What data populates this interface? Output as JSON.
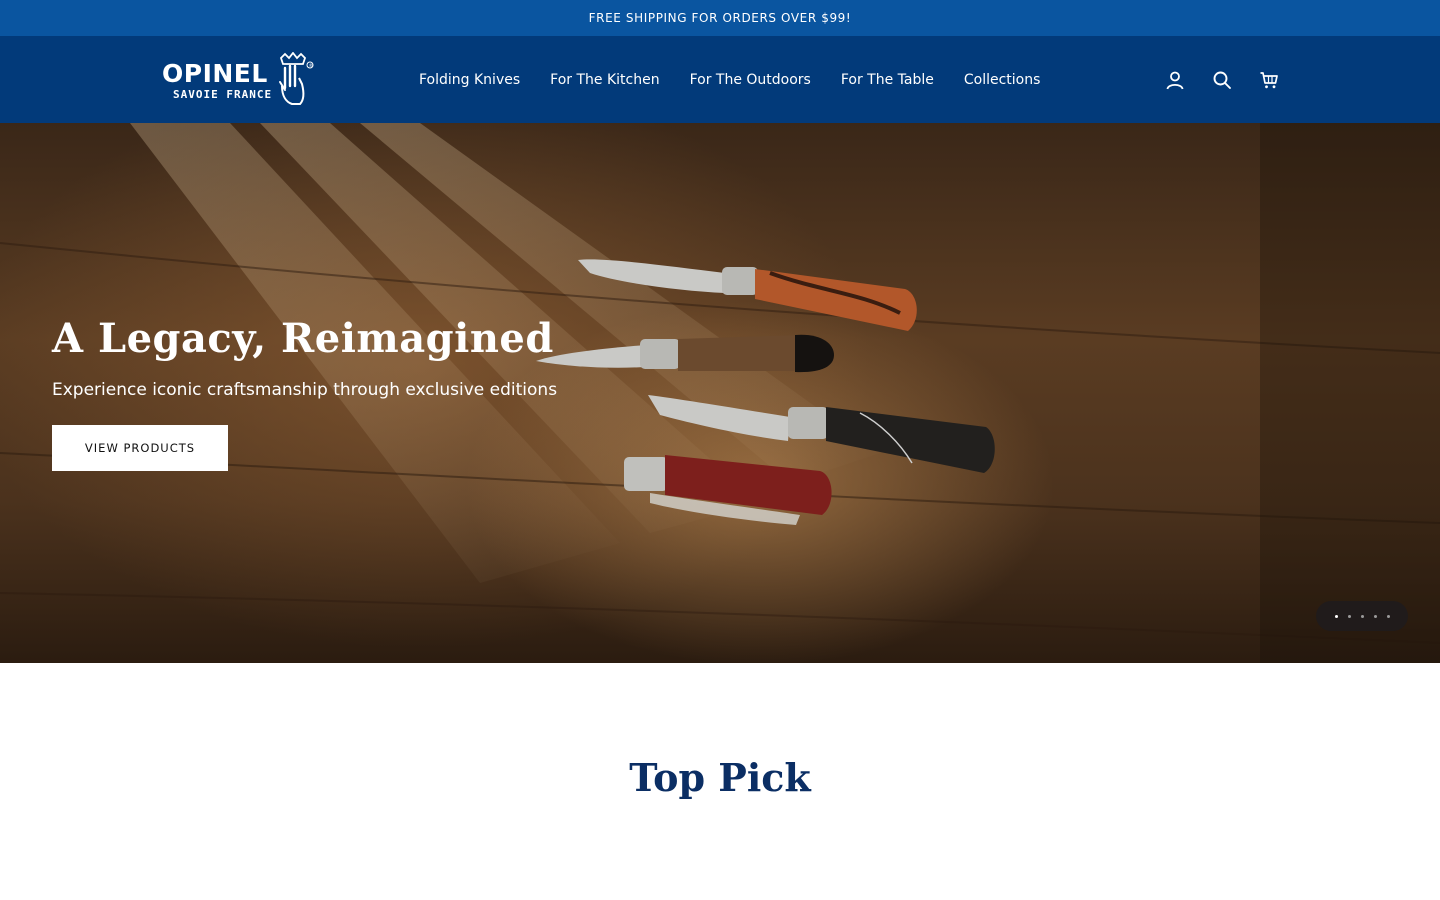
{
  "announcement": {
    "text": "FREE SHIPPING FOR ORDERS OVER $99!"
  },
  "header": {
    "logo": {
      "wordmark": "OPINEL",
      "tagline": "SAVOIE FRANCE",
      "registered": "®"
    },
    "nav": [
      {
        "label": "Folding Knives"
      },
      {
        "label": "For The Kitchen"
      },
      {
        "label": "For The Outdoors"
      },
      {
        "label": "For The Table"
      },
      {
        "label": "Collections"
      }
    ],
    "icons": [
      "account-icon",
      "search-icon",
      "cart-icon"
    ]
  },
  "hero": {
    "title": "A Legacy, Reimagined",
    "subtitle": "Experience iconic craftsmanship through exclusive editions",
    "cta_label": "VIEW PRODUCTS",
    "slides_total": 5,
    "active_slide": 1
  },
  "section": {
    "title": "Top Pick"
  },
  "colors": {
    "announcement_bg": "#0a55a0",
    "header_bg": "#023a7a",
    "title_navy": "#0b2e64",
    "button_bg": "#ffffff"
  }
}
